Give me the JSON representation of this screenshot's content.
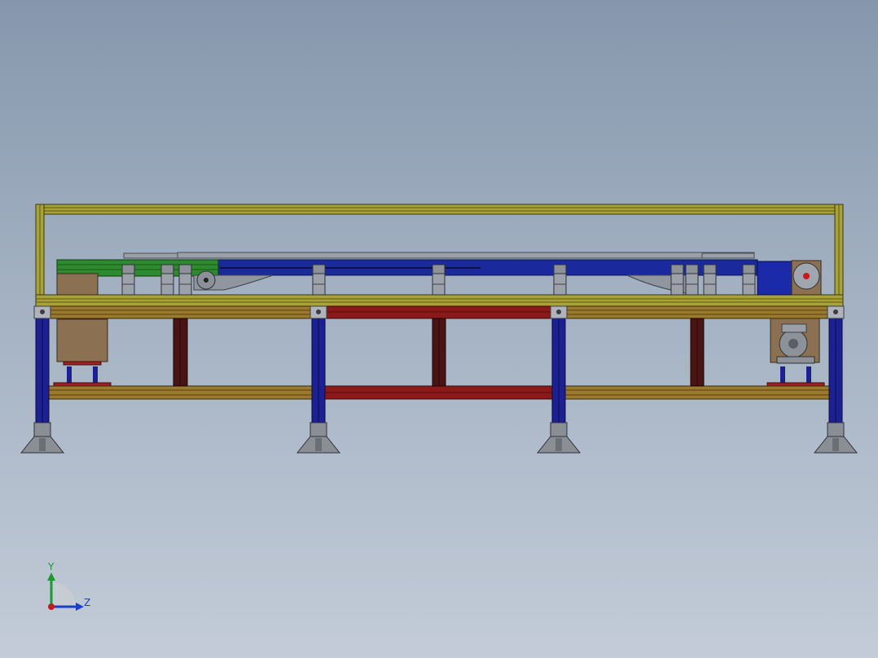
{
  "triad": {
    "y_label": "Y",
    "z_label": "Z",
    "y_color": "#1a9b2a",
    "z_color": "#1a3fc8",
    "x_color": "#c81a1a"
  },
  "colors": {
    "background_top": "#8697ad",
    "background_bottom": "#c3ccd8",
    "frame_profile": "#a8a238",
    "frame_dark": "#5d5a14",
    "rail": "#9a7a2e",
    "leg": "#1c2090",
    "conveyor_body": "#1a2a9c",
    "belt_green": "#2e8a2e",
    "red_beam": "#8a1a1a",
    "dark_red_post": "#4a1414",
    "motor_box": "#8c7052",
    "steel_grey": "#8a8f96"
  }
}
